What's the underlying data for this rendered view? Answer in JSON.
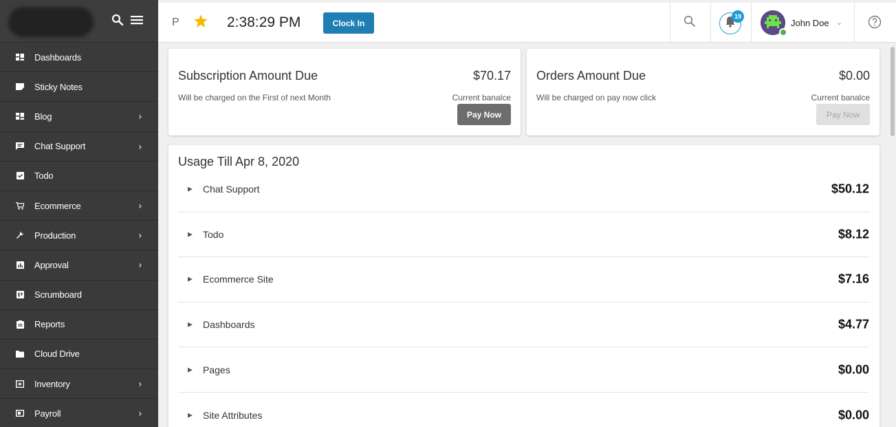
{
  "sidebar": {
    "items": [
      {
        "label": "Dashboards",
        "icon": "dashboard-icon",
        "has_submenu": false
      },
      {
        "label": "Sticky Notes",
        "icon": "sticky-note-icon",
        "has_submenu": false
      },
      {
        "label": "Blog",
        "icon": "blog-icon",
        "has_submenu": true
      },
      {
        "label": "Chat Support",
        "icon": "chat-icon",
        "has_submenu": true
      },
      {
        "label": "Todo",
        "icon": "checkbox-icon",
        "has_submenu": false
      },
      {
        "label": "Ecommerce",
        "icon": "cart-icon",
        "has_submenu": true
      },
      {
        "label": "Production",
        "icon": "wrench-icon",
        "has_submenu": true
      },
      {
        "label": "Approval",
        "icon": "chart-icon",
        "has_submenu": true
      },
      {
        "label": "Scrumboard",
        "icon": "board-icon",
        "has_submenu": false
      },
      {
        "label": "Reports",
        "icon": "reports-icon",
        "has_submenu": false
      },
      {
        "label": "Cloud Drive",
        "icon": "folder-icon",
        "has_submenu": false
      },
      {
        "label": "Inventory",
        "icon": "inventory-icon",
        "has_submenu": true
      },
      {
        "label": "Payroll",
        "icon": "payroll-icon",
        "has_submenu": true
      }
    ]
  },
  "topbar": {
    "p_label": "P",
    "time": "2:38:29 PM",
    "clock_in_label": "Clock In",
    "notification_count": "19",
    "user_name": "John Doe"
  },
  "subscription_card": {
    "title": "Subscription Amount Due",
    "amount": "$70.17",
    "subtitle": "Will be charged on the First of next Month",
    "balance_label": "Current banalce",
    "pay_label": "Pay Now"
  },
  "orders_card": {
    "title": "Orders Amount Due",
    "amount": "$0.00",
    "subtitle": "Will be charged on pay now click",
    "balance_label": "Current banalce",
    "pay_label": "Pay Now"
  },
  "usage": {
    "title": "Usage Till Apr 8, 2020",
    "rows": [
      {
        "label": "Chat Support",
        "amount": "$50.12"
      },
      {
        "label": "Todo",
        "amount": "$8.12"
      },
      {
        "label": "Ecommerce Site",
        "amount": "$7.16"
      },
      {
        "label": "Dashboards",
        "amount": "$4.77"
      },
      {
        "label": "Pages",
        "amount": "$0.00"
      },
      {
        "label": "Site Attributes",
        "amount": "$0.00"
      }
    ]
  },
  "colors": {
    "sidebar_bg": "#3a3a3a",
    "accent": "#1f7fb5",
    "badge": "#1e9bd7",
    "star": "#f5b800"
  }
}
